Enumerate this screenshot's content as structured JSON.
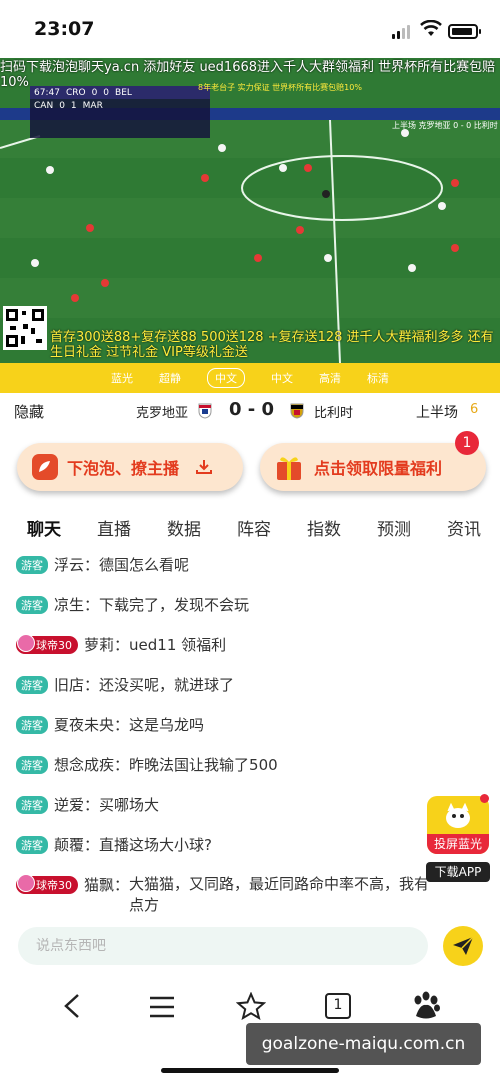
{
  "status": {
    "time": "23:07"
  },
  "video": {
    "ad_top": "扫码下载泡泡聊天ya.cn 添加好友 ued1668进入千人大群领福利 世界杯所有比赛包赔10%",
    "ad_bottom": "首存300送88+复存送88 500送128 +复存送128 进千人大群福利多多 还有生日礼金 过节礼金 VIP等级礼金送",
    "scorebug": {
      "clock": "67:47",
      "home": "CRO",
      "home_score": "0",
      "away_score": "0",
      "away": "BEL",
      "sub_home": "CAN",
      "sub_home_score": "0",
      "sub_away_score": "1",
      "sub_away": "MAR"
    },
    "overlay_line1": "8年老台子 实力保证 世界杯所有比赛包赔10%",
    "overlay_right": "上半场 克罗地亚 0 - 0 比利时"
  },
  "quality": {
    "options": [
      "蓝光",
      "超静",
      "中文",
      "中文",
      "高清",
      "标清"
    ],
    "selected": "中文"
  },
  "match": {
    "hide_label": "隐藏",
    "home": "克罗地亚",
    "score": "0 - 0",
    "away": "比利时",
    "period": "上半场",
    "period_count": "6"
  },
  "actions": {
    "download_label": "下泡泡、撩主播",
    "gift_label": "点击领取限量福利",
    "gift_badge": "1"
  },
  "tabs": [
    "聊天",
    "直播",
    "数据",
    "阵容",
    "指数",
    "预测",
    "资讯"
  ],
  "badges": {
    "guest": "游客",
    "vip": "球帝30"
  },
  "chat": [
    {
      "type": "guest",
      "user": "浮云",
      "text": "德国怎么看呢"
    },
    {
      "type": "guest",
      "user": "凉生",
      "text": "下载完了，发现不会玩"
    },
    {
      "type": "vip",
      "user": "萝莉",
      "text": "ued11 领福利"
    },
    {
      "type": "guest",
      "user": "旧店",
      "text": "还没买呢，就进球了"
    },
    {
      "type": "guest",
      "user": "夏夜未央",
      "text": "这是乌龙吗"
    },
    {
      "type": "guest",
      "user": "想念成疾",
      "text": "昨晚法国让我输了500"
    },
    {
      "type": "guest",
      "user": "逆爱",
      "text": "买哪场大"
    },
    {
      "type": "guest",
      "user": "颠覆",
      "text": "直播这场大小球?"
    },
    {
      "type": "vip",
      "user": "猫飘",
      "text": "大猫猫，又同路，最近同路命中率不高，我有点方"
    }
  ],
  "floating": {
    "cast_label": "投屏蓝光",
    "download_app": "下载APP"
  },
  "input": {
    "placeholder": "说点东西吧"
  },
  "nav": {
    "tab_count": "1"
  },
  "watermark": "goalzone-maiqu.com.cn",
  "colors": {
    "accent": "#f7d21a",
    "action": "#e33b1e",
    "guest": "#35b9a6",
    "vip": "#c8102e"
  }
}
